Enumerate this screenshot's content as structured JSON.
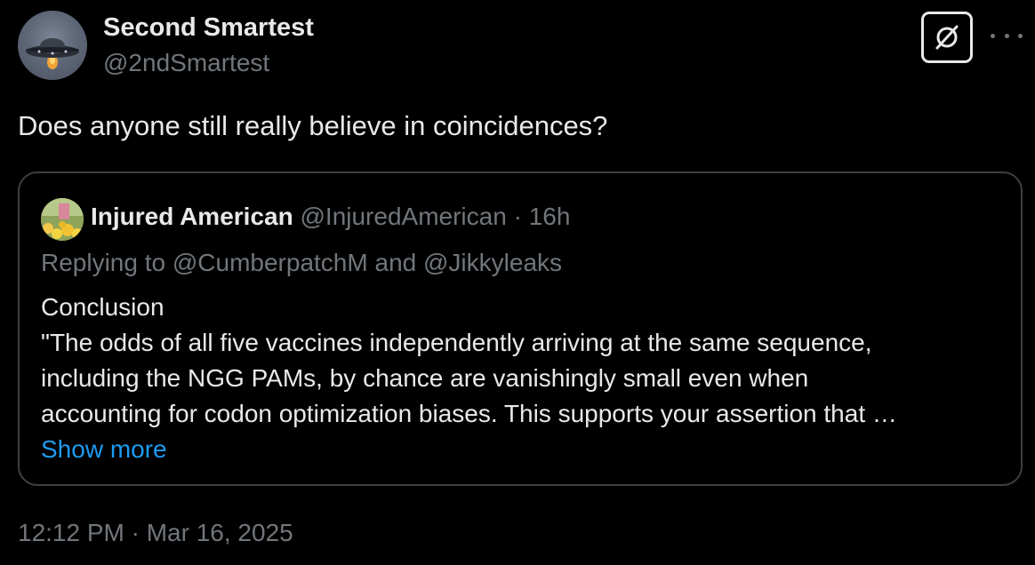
{
  "author": {
    "display_name": "Second Smartest",
    "handle": "@2ndSmartest",
    "avatar_icon": "ufo-icon"
  },
  "header": {
    "grok_icon": "grok-icon",
    "more_icon": "more-icon"
  },
  "tweet": {
    "text": "Does anyone still really believe in coincidences?",
    "timestamp": "12:12 PM · Mar 16, 2025"
  },
  "quoted_tweet": {
    "display_name": "Injured American",
    "handle": "@InjuredAmerican",
    "separator": "·",
    "age": "16h",
    "replying_prefix": "Replying to",
    "replying_to_1": "@CumberpatchM",
    "replying_and": "and",
    "replying_to_2": "@Jikkyleaks",
    "body_lines": [
      "Conclusion",
      "\"The odds of all five vaccines independently arriving at the same sequence,",
      "including the NGG PAMs, by chance are vanishingly small even when",
      "accounting for codon optimization biases. This supports your assertion that …"
    ],
    "show_more": "Show more"
  },
  "colors": {
    "background": "#000000",
    "primary_text": "#e7e9ea",
    "secondary_text": "#71767b",
    "link": "#1d9bf0",
    "border": "#3d4043"
  }
}
